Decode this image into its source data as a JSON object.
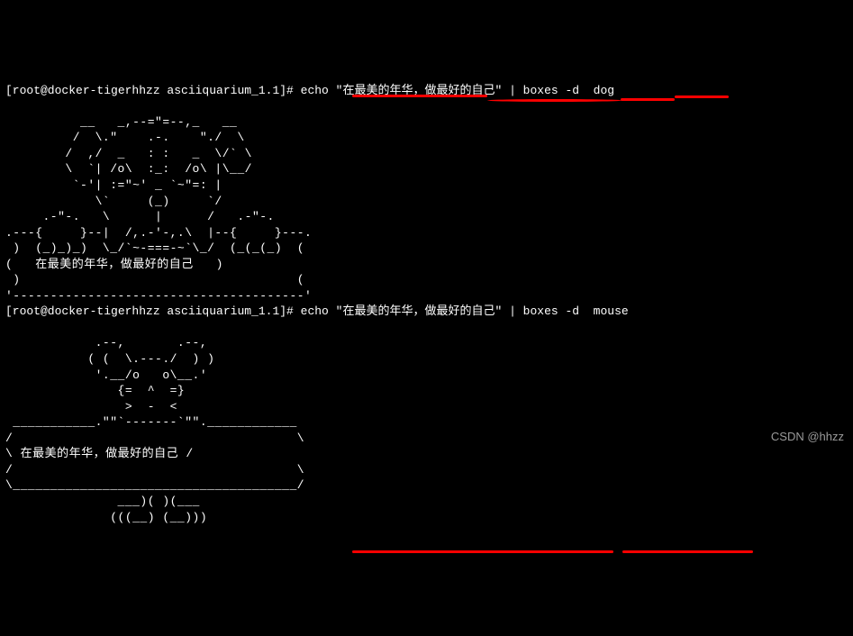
{
  "block1": {
    "prompt": "[root@docker-tigerhhzz asciiquarium_1.1]# ",
    "command": "echo \"在最美的年华，做最好的自己\" | boxes -d  dog",
    "ascii": "          __   _,--=\"=--,_   __\n         /  \\.\"    .-.    \"./  \\\n        /  ,/  _   : :   _  \\/` \\\n        \\  `| /o\\  :_:  /o\\ |\\__/\n         `-'| :=\"~' _ `~\"=: |\n            \\`     (_)     `/\n     .-\"-.   \\      |      /   .-\"-.\n.---{     }--|  /,.-'-,.\\  |--{     }---.\n )  (_)_)_)  \\_/`~-===-~`\\_/  (_(_(_)  (\n(   在最美的年华，做最好的自己   )\n )                                     (\n'---------------------------------------'"
  },
  "block2": {
    "prompt": "[root@docker-tigerhhzz asciiquarium_1.1]# ",
    "command": "echo \"在最美的年华，做最好的自己\" | boxes -d  mouse",
    "ascii": "            .--,       .--,\n           ( (  \\.---./  ) )\n            '.__/o   o\\__.'\n               {=  ^  =}\n                >  -  <\n ___________.\"\"`-------`\"\".____________\n/                                      \\\n\\ 在最美的年华，做最好的自己 /\n/                                      \\\n\\______________________________________/\n               ___)( )(___\n              (((__) (__)))"
  },
  "watermark": "CSDN @hhzz"
}
